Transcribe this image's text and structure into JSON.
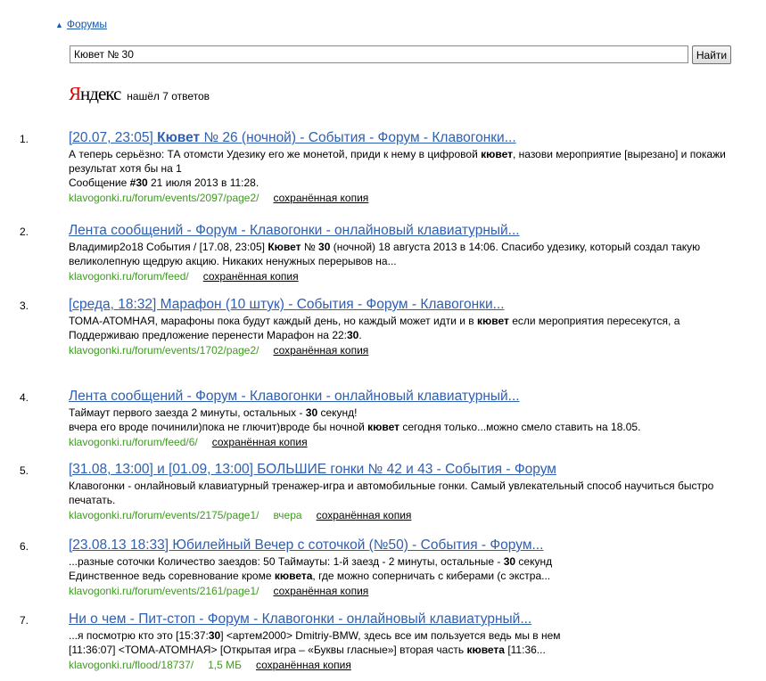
{
  "breadcrumb": {
    "link": "Форумы"
  },
  "search": {
    "value": "Кювет № 30",
    "button": "Найти"
  },
  "brand": {
    "logo": "Яндекс",
    "found": "нашёл 7 ответов"
  },
  "copy_label": "сохранённая копия",
  "results": [
    {
      "num": "1.",
      "title": "[20.07, 23:05] <b>Кювет</b> № 26 (ночной) - События - Форум - Клавогонки...",
      "lines": [
        "А теперь серьёзно: ТА отомсти Удезику его же монетой, приди к нему в цифровой <b>кювет</b>, назови мероприятие [вырезано] и покажи результат хотя бы на 1",
        "Сообщение <b>#30</b> 21 июля 2013 в 11:28."
      ],
      "url": "klavogonki.ru/forum/events/2097/page2/",
      "extra": ""
    },
    {
      "num": "2.",
      "title": "Лента сообщений - Форум - Клавогонки - онлайновый клавиатурный...",
      "lines": [
        "Владимир2o18 События / [17.08, 23:05] <b>Кювет</b> № <b>30</b> (ночной) 18 августа 2013 в 14:06. Спасибо удезику, который создал такую великолепную щедрую акцию. Никаких ненужных перерывов на..."
      ],
      "url": "klavogonki.ru/forum/feed/",
      "extra": ""
    },
    {
      "num": "3.",
      "title": "[среда, 18:32] Марафон (10 штук) - События - Форум - Клавогонки...",
      "lines": [
        "ТОМА-АТОМНАЯ, марафоны пока будут каждый день, но каждый может идти и в <b>кювет</b> если мероприятия пересекутся, а",
        "Поддерживаю предложение перенести Марафон на 22:<b>30</b>."
      ],
      "url": "klavogonki.ru/forum/events/1702/page2/",
      "extra": ""
    },
    {
      "num": "4.",
      "title": "Лента сообщений - Форум - Клавогонки - онлайновый клавиатурный...",
      "lines": [
        "Таймаут первого заезда 2 минуты, остальных - <b>30</b> секунд!",
        "вчера его вроде починили)пока не глючит)вроде бы ночной <b>кювет</b> сегодня только...можно смело ставить на 18.05."
      ],
      "url": "klavogonki.ru/forum/feed/6/",
      "extra": ""
    },
    {
      "num": "5.",
      "title": "[31.08, 13:00] и [01.09, 13:00] БОЛЬШИЕ гонки № 42 и 43 - События - Форум",
      "lines": [
        "Клавогонки - онлайновый клавиатурный тренажер-игра и автомобильные гонки. Самый увлекательный способ научиться быстро печатать."
      ],
      "url": "klavogonki.ru/forum/events/2175/page1/",
      "extra": "вчера"
    },
    {
      "num": "6.",
      "title": "[23.08.13 18:33] Юбилейный Вечер с соточкой (№50) - События - Форум...",
      "lines": [
        "...разные соточки Количество заездов: 50 Таймауты: 1-й заезд - 2 минуты, остальные - <b>30</b> секунд",
        "Единственное ведь соревнование кроме <b>кювета</b>, где можно соперничать с киберами (с экстра..."
      ],
      "url": "klavogonki.ru/forum/events/2161/page1/",
      "extra": ""
    },
    {
      "num": "7.",
      "title": "Ни о чем - Пит-стоп - Форум - Клавогонки - онлайновый клавиатурный...",
      "lines": [
        "...я посмотрю кто это [15:37:<b>30</b>] &lt;артем2000&gt; Dmitriy-BMW, здесь все им пользуется ведь мы в нем",
        "[11:36:07] &lt;ТОМА-АТОМНАЯ&gt; [Открытая игра – «Буквы гласные»] вторая часть <b>кювета</b> [11:36..."
      ],
      "url": "klavogonki.ru/flood/18737/",
      "extra": "1,5 МБ"
    }
  ]
}
